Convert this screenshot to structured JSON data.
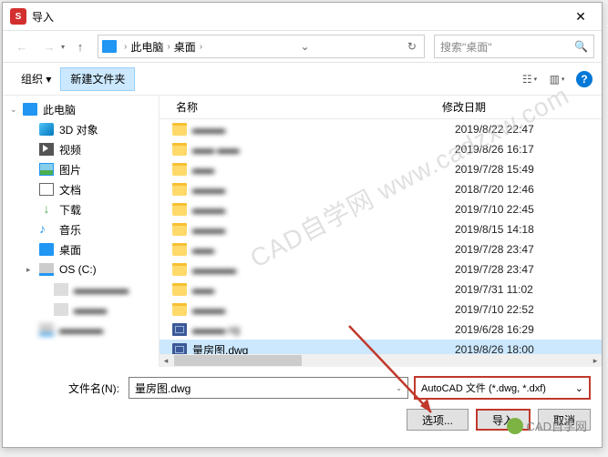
{
  "title": "导入",
  "nav": {
    "path_pc": "此电脑",
    "path_desktop": "桌面",
    "search_placeholder": "搜索\"桌面\""
  },
  "toolbar": {
    "organize": "组织 ▾",
    "new_folder": "新建文件夹"
  },
  "sidebar": {
    "pc": "此电脑",
    "items": [
      {
        "label": "3D 对象",
        "cls": "ico-3d"
      },
      {
        "label": "视频",
        "cls": "ico-vid"
      },
      {
        "label": "图片",
        "cls": "ico-img"
      },
      {
        "label": "文档",
        "cls": "ico-doc"
      },
      {
        "label": "下载",
        "cls": "ico-dl",
        "glyph": "↓"
      },
      {
        "label": "音乐",
        "cls": "ico-mus",
        "glyph": "♪"
      },
      {
        "label": "桌面",
        "cls": "ico-dsk"
      },
      {
        "label": "OS (C:)",
        "cls": "ico-drv",
        "exp": "▸"
      }
    ]
  },
  "columns": {
    "name": "名称",
    "date": "修改日期"
  },
  "files": [
    {
      "type": "folder",
      "name": "▬▬▬",
      "date": "2019/8/22 22:47"
    },
    {
      "type": "folder",
      "name": "▬▬ ▬▬",
      "date": "2019/8/26 16:17"
    },
    {
      "type": "folder",
      "name": "▬▬",
      "date": "2019/7/28 15:49"
    },
    {
      "type": "folder",
      "name": "▬▬▬",
      "date": "2018/7/20 12:46"
    },
    {
      "type": "folder",
      "name": "▬▬▬",
      "date": "2019/7/10 22:45"
    },
    {
      "type": "folder",
      "name": "▬▬▬",
      "date": "2019/8/15 14:18"
    },
    {
      "type": "folder",
      "name": "▬▬",
      "date": "2019/7/28 23:47"
    },
    {
      "type": "folder",
      "name": "▬▬▬▬",
      "date": "2019/7/28 23:47"
    },
    {
      "type": "folder",
      "name": "▬▬",
      "date": "2019/7/31 11:02"
    },
    {
      "type": "folder",
      "name": "▬▬▬",
      "date": "2019/7/10 22:52"
    },
    {
      "type": "dwg",
      "name": "▬▬▬.vg",
      "date": "2019/6/28 16:29"
    },
    {
      "type": "dwg",
      "name": "量房图.dwg",
      "date": "2019/8/26 18:00",
      "selected": true,
      "clear": true
    }
  ],
  "filename_label": "文件名(N):",
  "filename_value": "量房图.dwg",
  "filetype_value": "AutoCAD 文件 (*.dwg, *.dxf)",
  "buttons": {
    "options": "选项...",
    "import": "导入",
    "cancel": "取消"
  },
  "watermark": "CAD自学网 www.cadzxw.com",
  "wm_bottom": "CAD自学网"
}
